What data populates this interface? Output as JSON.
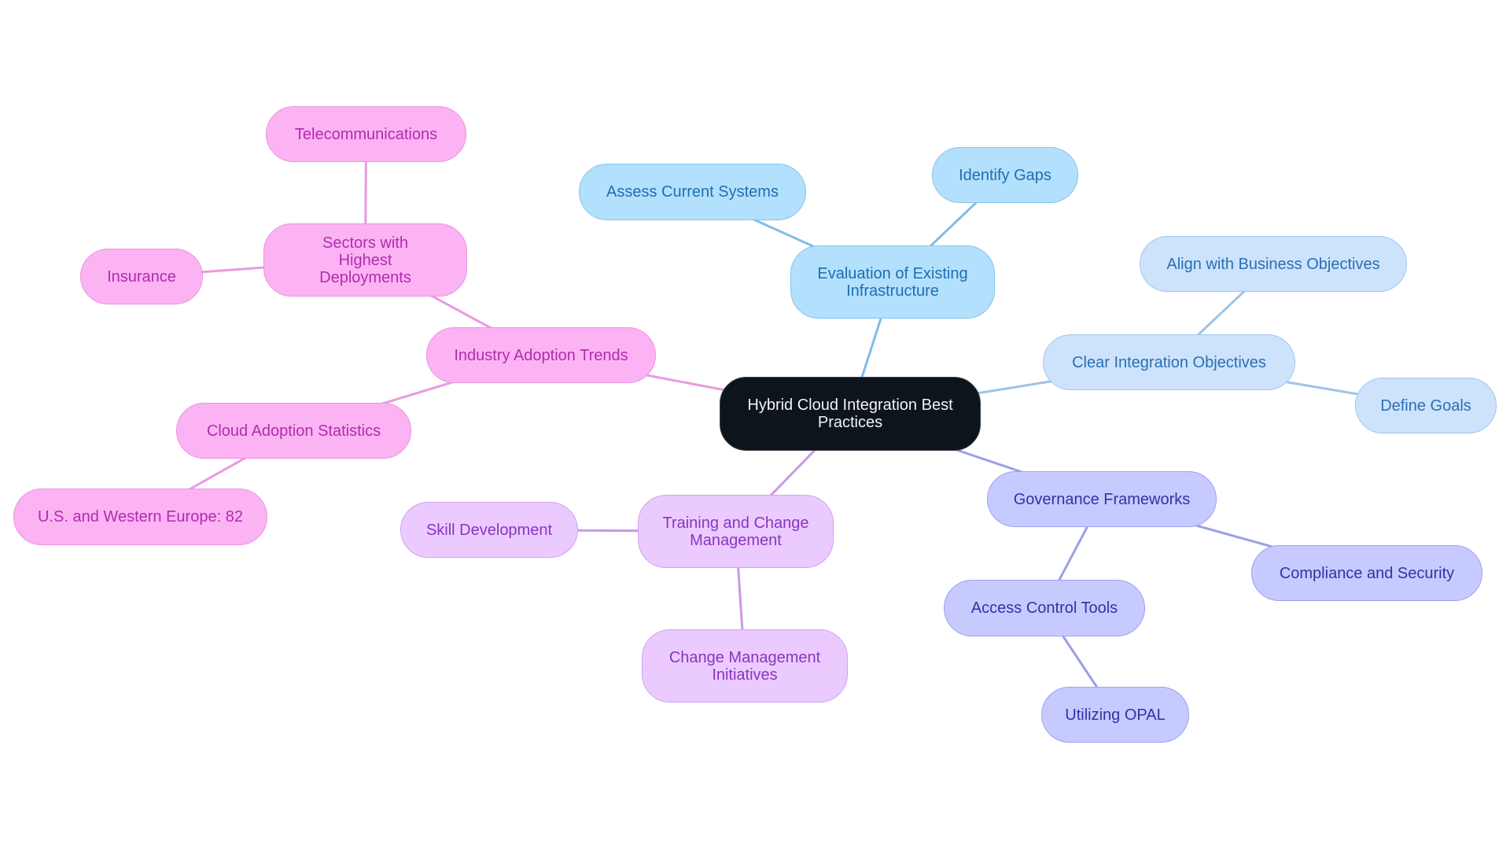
{
  "diagram": {
    "type": "mindmap",
    "root": {
      "id": "root",
      "label": "Hybrid Cloud Integration Best Practices"
    },
    "colors": {
      "pink_edge": "#e99ae0",
      "blue_edge": "#7fbde6",
      "lblue_edge": "#9cc3ea",
      "indigo_edge": "#9a9fe6",
      "violet_edge": "#c899e6"
    },
    "nodes": [
      {
        "id": "iat",
        "label": "Industry Adoption Trends",
        "parent": "root",
        "theme": "pink"
      },
      {
        "id": "swhd",
        "label": "Sectors with Highest Deployments",
        "parent": "iat",
        "theme": "pink"
      },
      {
        "id": "tel",
        "label": "Telecommunications",
        "parent": "swhd",
        "theme": "pink"
      },
      {
        "id": "ins",
        "label": "Insurance",
        "parent": "swhd",
        "theme": "pink"
      },
      {
        "id": "cas",
        "label": "Cloud Adoption Statistics",
        "parent": "iat",
        "theme": "pink"
      },
      {
        "id": "uswe",
        "label": "U.S. and Western Europe: 82",
        "parent": "cas",
        "theme": "pink"
      },
      {
        "id": "eei",
        "label": "Evaluation of Existing Infrastructure",
        "parent": "root",
        "theme": "blue"
      },
      {
        "id": "acs",
        "label": "Assess Current Systems",
        "parent": "eei",
        "theme": "blue"
      },
      {
        "id": "ig",
        "label": "Identify Gaps",
        "parent": "eei",
        "theme": "blue"
      },
      {
        "id": "cio",
        "label": "Clear Integration Objectives",
        "parent": "root",
        "theme": "lblue"
      },
      {
        "id": "awbo",
        "label": "Align with Business Objectives",
        "parent": "cio",
        "theme": "lblue"
      },
      {
        "id": "dg",
        "label": "Define Goals",
        "parent": "cio",
        "theme": "lblue"
      },
      {
        "id": "gf",
        "label": "Governance Frameworks",
        "parent": "root",
        "theme": "indigo"
      },
      {
        "id": "cs",
        "label": "Compliance and Security",
        "parent": "gf",
        "theme": "indigo"
      },
      {
        "id": "act",
        "label": "Access Control Tools",
        "parent": "gf",
        "theme": "indigo"
      },
      {
        "id": "opal",
        "label": "Utilizing OPAL",
        "parent": "act",
        "theme": "indigo"
      },
      {
        "id": "tcm",
        "label": "Training and Change Management",
        "parent": "root",
        "theme": "violet"
      },
      {
        "id": "sd",
        "label": "Skill Development",
        "parent": "tcm",
        "theme": "violet"
      },
      {
        "id": "cmi",
        "label": "Change Management Initiatives",
        "parent": "tcm",
        "theme": "violet"
      }
    ]
  }
}
